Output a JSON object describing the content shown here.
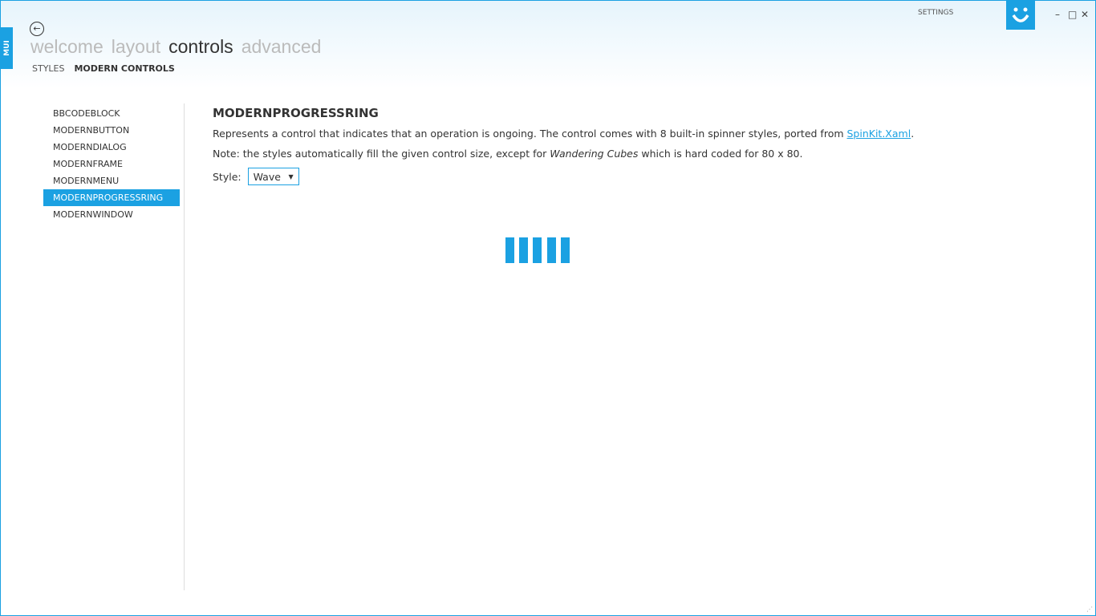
{
  "window": {
    "title": "SETTINGS",
    "mui_tab": "MUI",
    "controls": {
      "minimize": "–",
      "maximize": "□",
      "close": "✕"
    }
  },
  "accent": "#1ba1e2",
  "nav": {
    "back_icon": "arrow-left-icon",
    "menu": [
      "welcome",
      "layout",
      "controls",
      "advanced"
    ],
    "selected_menu": "controls",
    "sub": [
      "STYLES",
      "MODERN CONTROLS"
    ],
    "selected_sub": "MODERN CONTROLS"
  },
  "sidebar": {
    "items": [
      "BBCODEBLOCK",
      "MODERNBUTTON",
      "MODERNDIALOG",
      "MODERNFRAME",
      "MODERNMENU",
      "MODERNPROGRESSRING",
      "MODERNWINDOW"
    ],
    "selected": "MODERNPROGRESSRING"
  },
  "content": {
    "title": "MODERNPROGRESSRING",
    "desc_before": "Represents a control that indicates that an operation is ongoing. The control comes with 8 built-in spinner styles, ported from ",
    "desc_link": "SpinKit.Xaml",
    "desc_after": ".",
    "note_before": "Note: the styles automatically fill the given control size, except for ",
    "note_em": "Wandering Cubes",
    "note_after": " which is hard coded for 80 x 80.",
    "style_label": "Style:",
    "style_value": "Wave"
  }
}
